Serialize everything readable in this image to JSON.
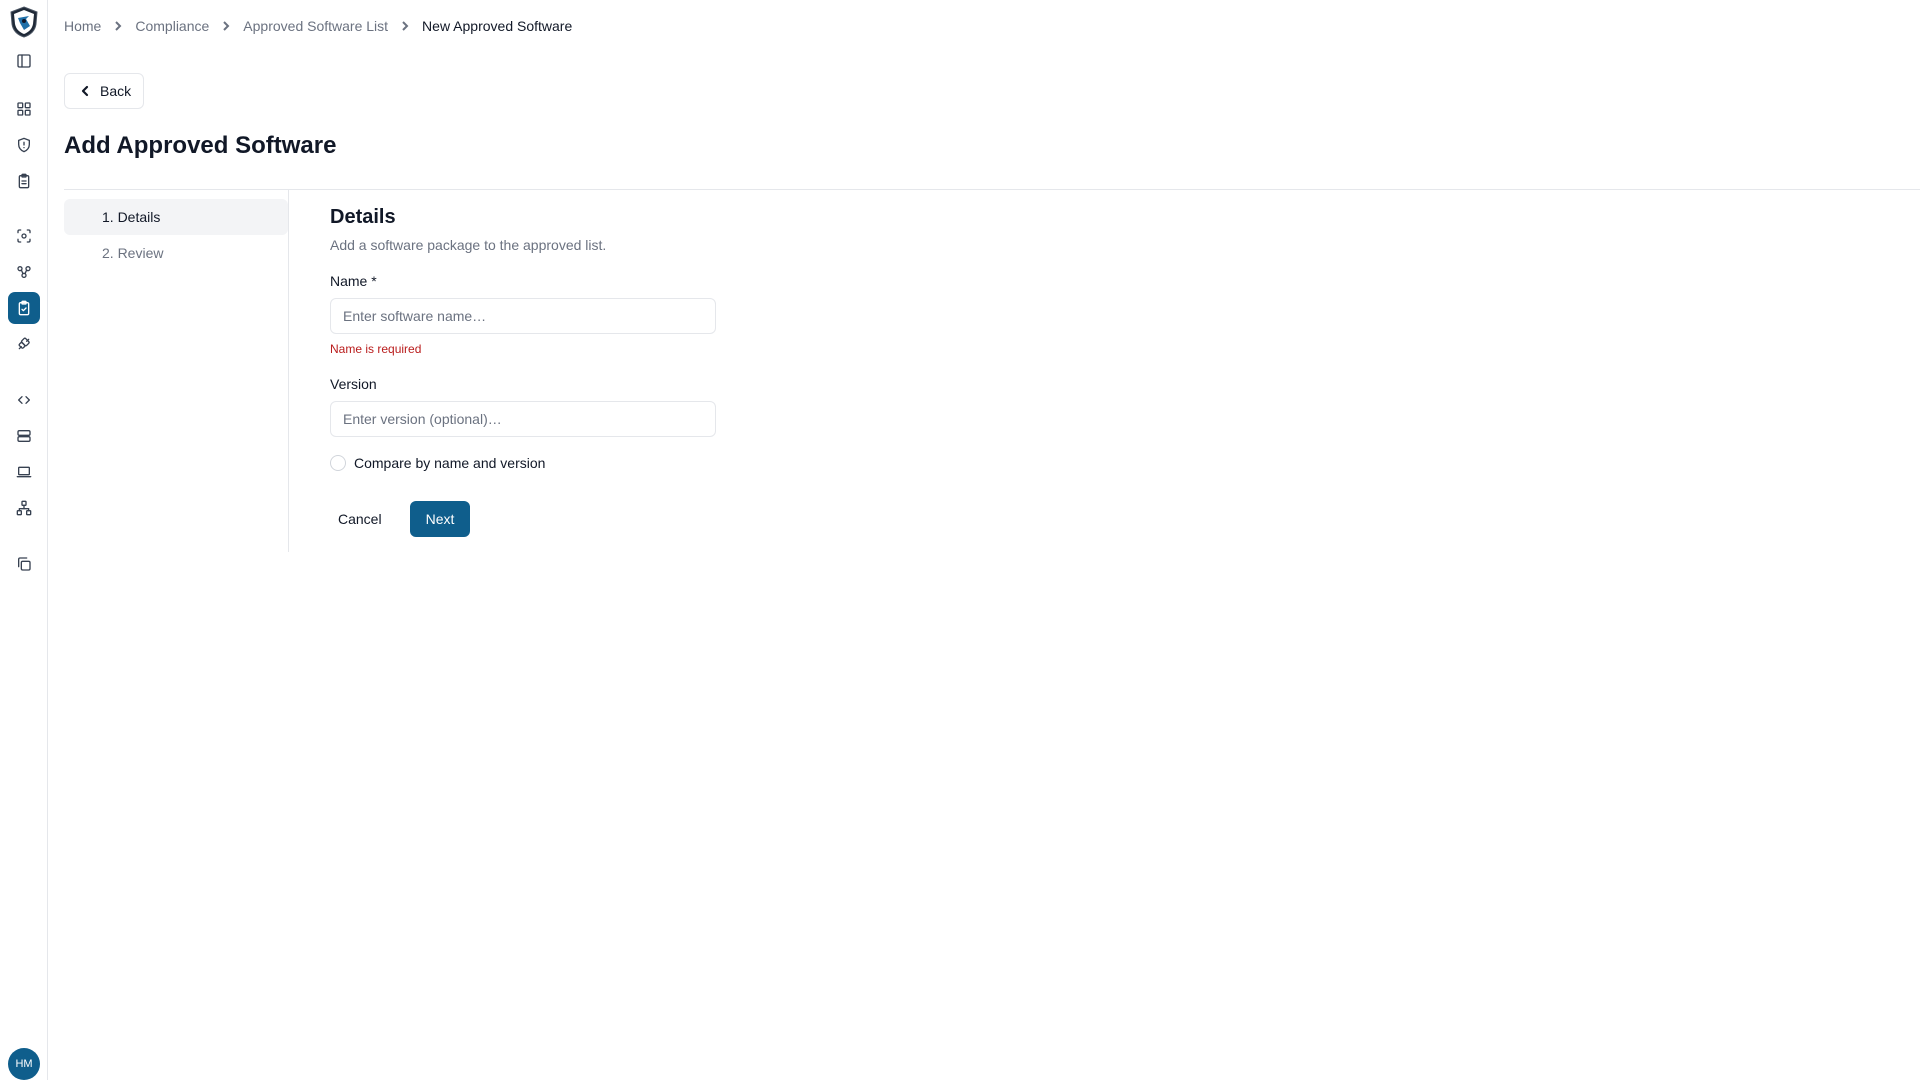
{
  "breadcrumb": {
    "items": [
      "Home",
      "Compliance",
      "Approved Software List",
      "New Approved Software"
    ]
  },
  "back_label": "Back",
  "page_title": "Add Approved Software",
  "steps": [
    "1. Details",
    "2. Review"
  ],
  "form": {
    "heading": "Details",
    "description": "Add a software package to the approved list.",
    "name_label": "Name *",
    "name_placeholder": "Enter software name…",
    "name_error": "Name is required",
    "version_label": "Version",
    "version_placeholder": "Enter version (optional)…",
    "compare_label": "Compare by name and version",
    "cancel_label": "Cancel",
    "next_label": "Next"
  },
  "user": {
    "initials": "HM"
  },
  "colors": {
    "accent": "#0f5e8c",
    "error": "#b91c1c"
  },
  "sidebar": {
    "icons": [
      "sidebar-toggle-icon",
      "dashboard-icon",
      "shield-icon",
      "clipboard-icon",
      "scan-icon",
      "nodes-icon",
      "clipboard-check-icon",
      "plug-icon",
      "code-icon",
      "server-icon",
      "laptop-icon",
      "network-icon",
      "copy-icon"
    ],
    "active": "clipboard-check-icon"
  }
}
